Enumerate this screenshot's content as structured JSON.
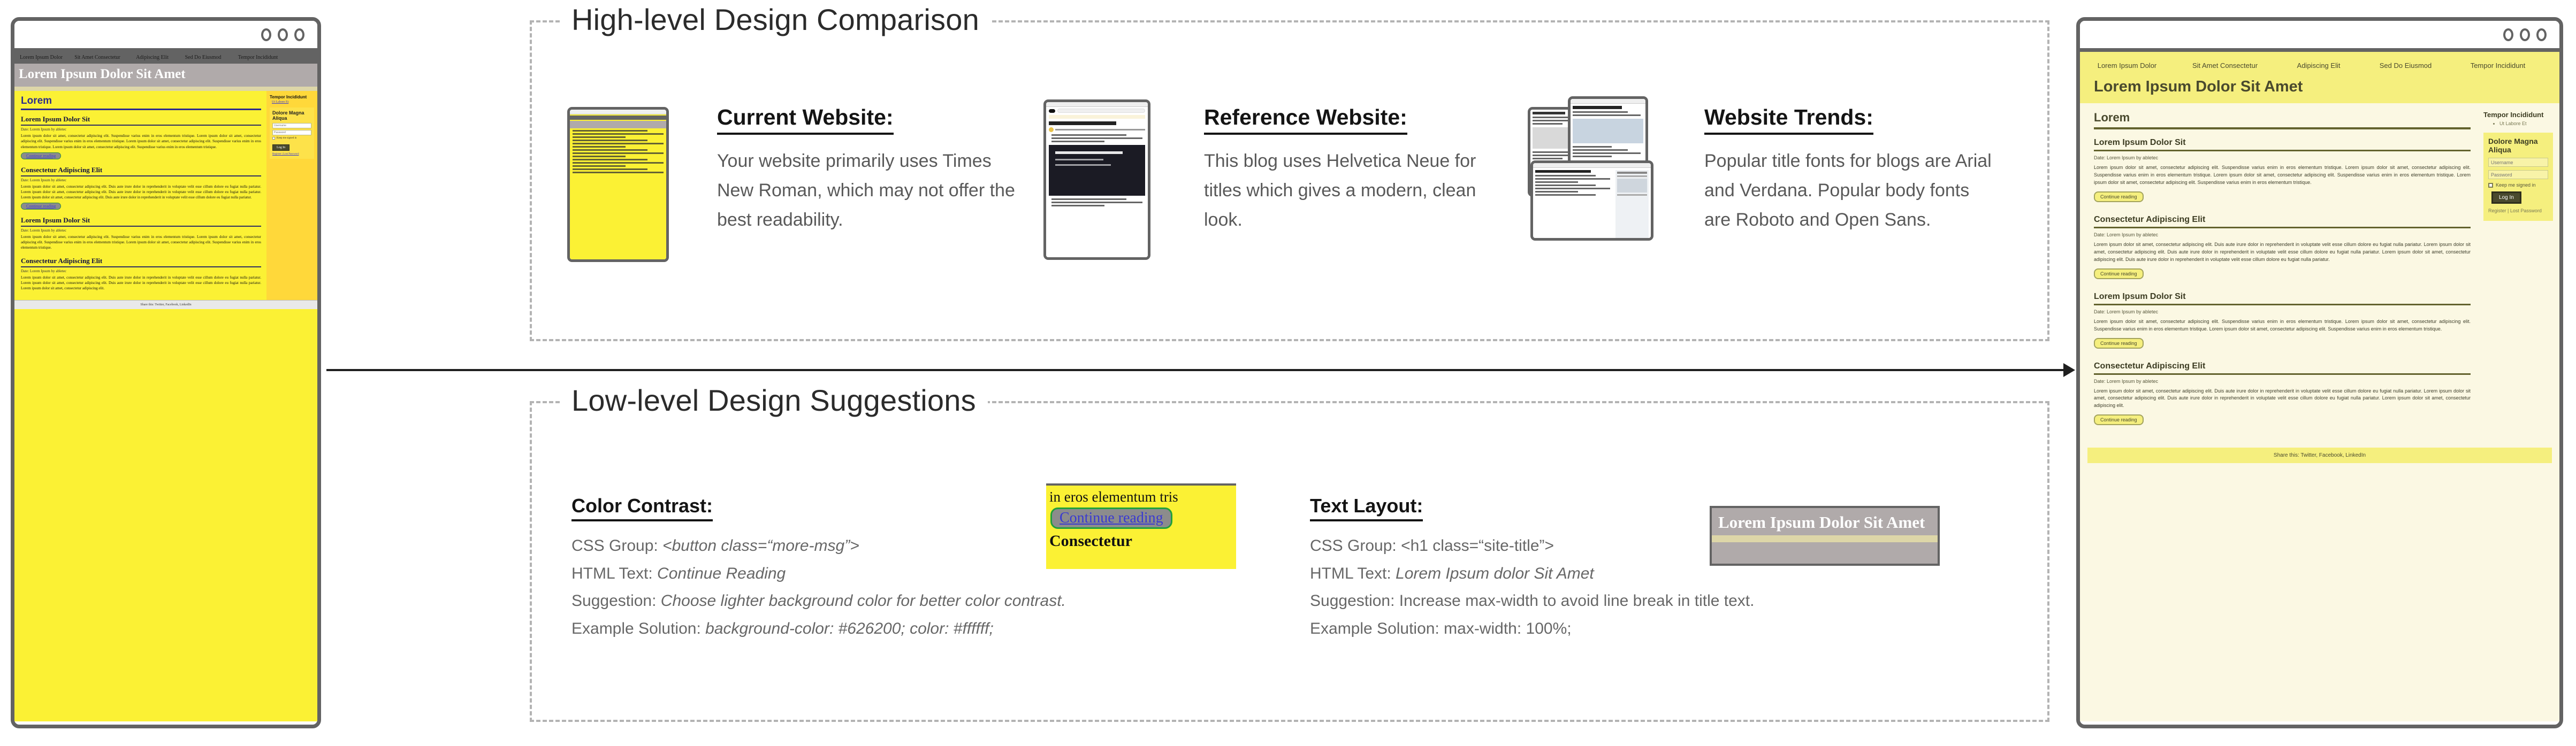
{
  "panels": {
    "high": {
      "title": "High-level Design Comparison"
    },
    "low": {
      "title": "Low-level Design Suggestions"
    }
  },
  "high_level_columns": [
    {
      "heading": "Current Website:",
      "text": "Your website primarily uses Times New Roman, which may not offer the best readability."
    },
    {
      "heading": "Reference Website:",
      "text": "This blog uses Helvetica Neue for titles which gives a modern, clean look."
    },
    {
      "heading": "Website Trends:",
      "text": "Popular title fonts for blogs are Arial and Verdana. Popular body fonts are Roboto and Open Sans."
    }
  ],
  "low_level_columns": [
    {
      "heading": "Color Contrast:",
      "rows": [
        {
          "label": "CSS Group: ",
          "value": "<button class=“more-msg”>"
        },
        {
          "label": "HTML Text: ",
          "value": "Continue Reading"
        },
        {
          "label": "Suggestion: ",
          "value": "Choose lighter background color for better color contrast."
        },
        {
          "label": "Example Solution: ",
          "value": "background-color: #626200; color: #ffffff;"
        }
      ],
      "example": {
        "line1": "in eros elementum tris",
        "button": "Continue reading",
        "line2": "Consectetur"
      }
    },
    {
      "heading": "Text Layout:",
      "rows": [
        {
          "label": "CSS Group: ",
          "value": "<h1 class=“site-title”>"
        },
        {
          "label": "HTML Text: ",
          "value": "Lorem Ipsum dolor Sit Amet"
        },
        {
          "label": "Suggestion: ",
          "value": "Increase max-width to avoid line break in title text."
        },
        {
          "label": "Example Solution: ",
          "value": "max-width: 100%;"
        }
      ],
      "example": {
        "title": "Lorem Ipsum Dolor Sit Amet"
      }
    }
  ],
  "current_window": {
    "nav": [
      "Lorem Ipsum Dolor",
      "Sit Amet Consectetur",
      "Adipiscing Elit",
      "Sed Do Eiusmod",
      "Tempor Incididunt"
    ],
    "site_title": "Lorem Ipsum Dolor Sit Amet",
    "section_title": "Lorem",
    "articles": [
      {
        "title": "Lorem Ipsum Dolor Sit",
        "meta": "Date: Lorem Ipsum by abletec",
        "body": "Lorem ipsum dolor sit amet, consectetur adipiscing elit. Suspendisse varius enim in eros elementum tristique. Lorem ipsum dolor sit amet, consectetur adipiscing elit. Suspendisse varius enim in eros elementum tristique. Lorem ipsum dolor sit amet, consectetur adipiscing elit. Suspendisse varius enim in eros elementum tristique. Lorem ipsum dolor sit amet, consectetur adipiscing elit. Suspendisse varius enim in eros elementum tristique.",
        "button": "Continue reading"
      },
      {
        "title": "Consectetur Adipiscing Elit",
        "meta": "Date: Lorem Ipsum by abletec",
        "body": "Lorem ipsum dolor sit amet, consectetur adipiscing elit. Duis aute irure dolor in reprehenderit in voluptate velit esse cillum dolore eu fugiat nulla pariatur. Lorem ipsum dolor sit amet, consectetur adipiscing elit. Duis aute irure dolor in reprehenderit in voluptate velit esse cillum dolore eu fugiat nulla pariatur. Lorem ipsum dolor sit amet, consectetur adipiscing elit. Duis aute irure dolor in reprehenderit in voluptate velit esse cillum dolore eu fugiat nulla pariatur.",
        "button": "Continue reading"
      },
      {
        "title": "Lorem Ipsum Dolor Sit",
        "meta": "Date: Lorem Ipsum by abletec",
        "body": "Lorem ipsum dolor sit amet, consectetur adipiscing elit. Suspendisse varius enim in eros elementum tristique. Lorem ipsum dolor sit amet, consectetur adipiscing elit. Suspendisse varius enim in eros elementum tristique. Lorem ipsum dolor sit amet, consectetur adipiscing elit. Suspendisse varius enim in eros elementum tristique.",
        "button": "Continue reading"
      },
      {
        "title": "Consectetur Adipiscing Elit",
        "meta": "Date: Lorem Ipsum by abletec",
        "body": "Lorem ipsum dolor sit amet, consectetur adipiscing elit. Duis aute irure dolor in reprehenderit in voluptate velit esse cillum dolore eu fugiat nulla pariatur. Lorem ipsum dolor sit amet, consectetur adipiscing elit. Duis aute irure dolor in reprehenderit in voluptate velit esse cillum dolore eu fugiat nulla pariatur. Lorem ipsum dolor sit amet, consectetur adipiscing elit.",
        "button": "Continue reading"
      }
    ],
    "sidebar": {
      "heading": "Tempor Incididunt",
      "subitem": "Ut Labore Et",
      "widget_title": "Dolore Magna Aliqua",
      "username_placeholder": "Username",
      "password_placeholder": "Password",
      "checkbox_label": "Keep me signed in",
      "login_button": "Log In",
      "links": "Register  |  Lost Password"
    },
    "footer": "Share this: Twitter, Facebook, LinkedIn"
  },
  "improved_window": {
    "nav": [
      "Lorem Ipsum Dolor",
      "Sit Amet Consectetur",
      "Adipiscing Elit",
      "Sed Do Eiusmod",
      "Tempor Incididunt"
    ],
    "site_title": "Lorem Ipsum Dolor Sit Amet",
    "section_title": "Lorem",
    "articles": [
      {
        "title": "Lorem Ipsum Dolor Sit",
        "meta": "Date: Lorem Ipsum by abletec",
        "body": "Lorem ipsum dolor sit amet, consectetur adipiscing elit. Suspendisse varius enim in eros elementum tristique. Lorem ipsum dolor sit amet, consectetur adipiscing elit. Suspendisse varius enim in eros elementum tristique. Lorem ipsum dolor sit amet, consectetur adipiscing elit. Suspendisse varius enim in eros elementum tristique. Lorem ipsum dolor sit amet, consectetur adipiscing elit. Suspendisse varius enim in eros elementum tristique.",
        "button": "Continue reading"
      },
      {
        "title": "Consectetur Adipiscing Elit",
        "meta": "Date: Lorem Ipsum by abletec",
        "body": "Lorem ipsum dolor sit amet, consectetur adipiscing elit. Duis aute irure dolor in reprehenderit in voluptate velit esse cillum dolore eu fugiat nulla pariatur. Lorem ipsum dolor sit amet, consectetur adipiscing elit. Duis aute irure dolor in reprehenderit in voluptate velit esse cillum dolore eu fugiat nulla pariatur. Lorem ipsum dolor sit amet, consectetur adipiscing elit. Duis aute irure dolor in reprehenderit in voluptate velit esse cillum dolore eu fugiat nulla pariatur.",
        "button": "Continue reading"
      },
      {
        "title": "Lorem Ipsum Dolor Sit",
        "meta": "Date: Lorem Ipsum by abletec",
        "body": "Lorem ipsum dolor sit amet, consectetur adipiscing elit. Suspendisse varius enim in eros elementum tristique. Lorem ipsum dolor sit amet, consectetur adipiscing elit. Suspendisse varius enim in eros elementum tristique. Lorem ipsum dolor sit amet, consectetur adipiscing elit. Suspendisse varius enim in eros elementum tristique.",
        "button": "Continue reading"
      },
      {
        "title": "Consectetur Adipiscing Elit",
        "meta": "Date: Lorem Ipsum by abletec",
        "body": "Lorem ipsum dolor sit amet, consectetur adipiscing elit. Duis aute irure dolor in reprehenderit in voluptate velit esse cillum dolore eu fugiat nulla pariatur. Lorem ipsum dolor sit amet, consectetur adipiscing elit. Duis aute irure dolor in reprehenderit in voluptate velit esse cillum dolore eu fugiat nulla pariatur. Lorem ipsum dolor sit amet, consectetur adipiscing elit.",
        "button": "Continue reading"
      }
    ],
    "sidebar": {
      "heading": "Tempor Incididunt",
      "subitem": "Ut Labore Et",
      "widget_title": "Dolore Magna Aliqua",
      "username_placeholder": "Username",
      "password_placeholder": "Password",
      "checkbox_label": "Keep me signed in",
      "login_button": "Log In",
      "links": "Register  |  Lost Password"
    },
    "footer": "Share this: Twitter, Facebook, LinkedIn"
  },
  "colors": {
    "accent_yellow": "#fbf134",
    "soft_yellow": "#f5ef7e",
    "cream": "#fbf8e3",
    "olive": "#4a4a2e",
    "chrome_grey": "#636363",
    "panel_dash": "#b3b3b3"
  }
}
